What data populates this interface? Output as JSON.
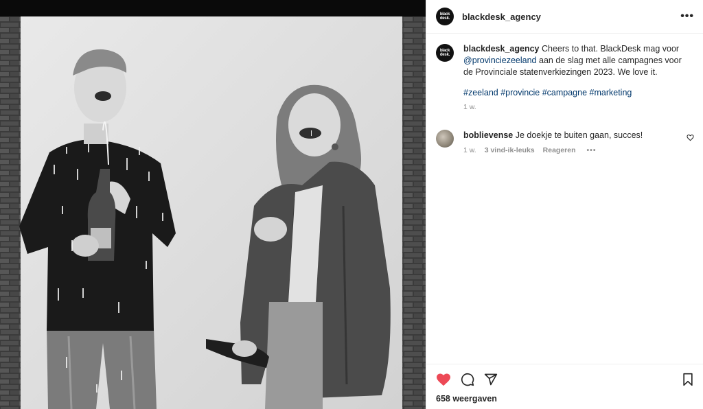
{
  "post": {
    "username": "blackdesk_agency",
    "avatar_text": [
      "black",
      "desk."
    ]
  },
  "caption": {
    "username": "blackdesk_agency",
    "text_1": " Cheers to that. BlackDesk mag voor ",
    "mention": "@provinciezeeland",
    "text_2": " aan de slag met alle campagnes voor de Provinciale statenverkiezingen 2023. We love it.",
    "hashtags": [
      "#zeeland",
      "#provincie",
      "#campagne",
      "#marketing"
    ],
    "time": "1 w."
  },
  "comments": [
    {
      "username": "boblievense",
      "text": " Je doekje te buiten gaan, succes!",
      "time": "1 w.",
      "likes": "3 vind-ik-leuks",
      "reply": "Reageren",
      "more": "•••"
    }
  ],
  "actions": {
    "liked": true,
    "like_color": "#ed4956",
    "icons": [
      "heart-icon",
      "comment-icon",
      "share-icon",
      "bookmark-icon"
    ]
  },
  "views": "658 weergaven",
  "more_label": "•••"
}
